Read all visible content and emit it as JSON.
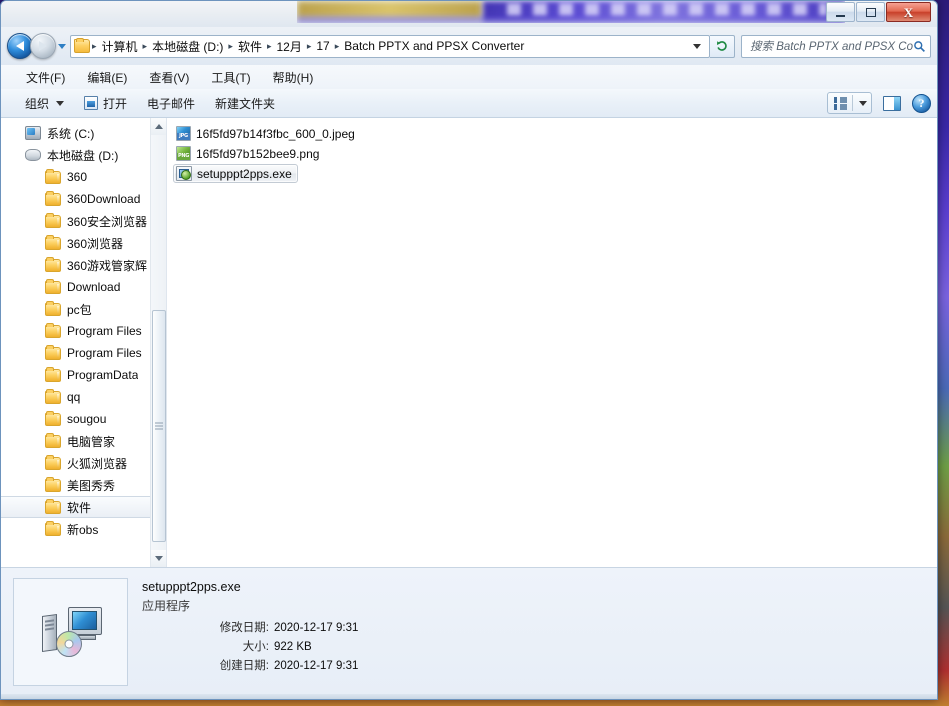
{
  "window": {
    "title_obscured": true,
    "controls": {
      "minimize": "minimize",
      "maximize": "maximize",
      "close": "close"
    }
  },
  "address_bar": {
    "back_tooltip": "后退",
    "forward_tooltip": "前进",
    "folder_icon": "folder-icon",
    "breadcrumbs": [
      "计算机",
      "本地磁盘 (D:)",
      "软件",
      "12月",
      "17",
      "Batch PPTX and PPSX Converter"
    ],
    "separator": "▸",
    "refresh_icon": "refresh-icon",
    "search": {
      "placeholder": "搜索 Batch PPTX and PPSX Conver...",
      "value": "",
      "icon": "search-icon"
    }
  },
  "menubar": [
    {
      "label": "文件(F)",
      "key": "F"
    },
    {
      "label": "编辑(E)",
      "key": "E"
    },
    {
      "label": "查看(V)",
      "key": "V"
    },
    {
      "label": "工具(T)",
      "key": "T"
    },
    {
      "label": "帮助(H)",
      "key": "H"
    }
  ],
  "toolbar": {
    "organize": "组织",
    "open": "打开",
    "email": "电子邮件",
    "new_folder": "新建文件夹",
    "view_icon": "view-options-icon",
    "preview_pane_icon": "preview-pane-icon",
    "help_icon": "help-icon"
  },
  "nav_pane": {
    "items": [
      {
        "label": "系统 (C:)",
        "icon": "drive-c-icon",
        "level": 1,
        "selected": false
      },
      {
        "label": "本地磁盘 (D:)",
        "icon": "drive-d-icon",
        "level": 1,
        "selected": false
      },
      {
        "label": "360",
        "icon": "folder-icon",
        "level": 2,
        "selected": false
      },
      {
        "label": "360Download",
        "icon": "folder-icon",
        "level": 2,
        "selected": false
      },
      {
        "label": "360安全浏览器",
        "icon": "folder-icon",
        "level": 2,
        "selected": false
      },
      {
        "label": "360浏览器",
        "icon": "folder-icon",
        "level": 2,
        "selected": false
      },
      {
        "label": "360游戏管家辉",
        "icon": "folder-icon",
        "level": 2,
        "selected": false
      },
      {
        "label": "Download",
        "icon": "folder-icon",
        "level": 2,
        "selected": false
      },
      {
        "label": "pc包",
        "icon": "folder-icon",
        "level": 2,
        "selected": false
      },
      {
        "label": "Program Files",
        "icon": "folder-icon",
        "level": 2,
        "selected": false
      },
      {
        "label": "Program Files",
        "icon": "folder-icon",
        "level": 2,
        "selected": false
      },
      {
        "label": "ProgramData",
        "icon": "folder-icon",
        "level": 2,
        "selected": false
      },
      {
        "label": "qq",
        "icon": "folder-icon",
        "level": 2,
        "selected": false
      },
      {
        "label": "sougou",
        "icon": "folder-icon",
        "level": 2,
        "selected": false
      },
      {
        "label": "电脑管家",
        "icon": "folder-icon",
        "level": 2,
        "selected": false
      },
      {
        "label": "火狐浏览器",
        "icon": "folder-icon",
        "level": 2,
        "selected": false
      },
      {
        "label": "美图秀秀",
        "icon": "folder-icon",
        "level": 2,
        "selected": false
      },
      {
        "label": "软件",
        "icon": "folder-icon",
        "level": 2,
        "selected": true
      },
      {
        "label": "新obs",
        "icon": "folder-icon",
        "level": 2,
        "selected": false
      }
    ]
  },
  "file_list": {
    "files": [
      {
        "name": "16f5fd97b14f3fbc_600_0.jpeg",
        "icon": "jpeg-file-icon",
        "badge": "JPG",
        "selected": false
      },
      {
        "name": "16f5fd97b152bee9.png",
        "icon": "png-file-icon",
        "badge": "PNG",
        "selected": false
      },
      {
        "name": "setupppt2pps.exe",
        "icon": "exe-file-icon",
        "badge": "",
        "selected": true
      }
    ]
  },
  "details_pane": {
    "thumbnail_icon": "setup-program-icon",
    "file_name": "setupppt2pps.exe",
    "file_type": "应用程序",
    "rows": [
      {
        "label": "修改日期:",
        "value": "2020-12-17 9:31"
      },
      {
        "label": "大小:",
        "value": "922 KB"
      },
      {
        "label": "创建日期:",
        "value": "2020-12-17 9:31"
      }
    ]
  },
  "colors": {
    "accent_blue": "#2f8ddc",
    "close_red": "#c8402a",
    "folder_yellow": "#fdd468",
    "details_bg": "#eef3fa",
    "selection_border": "#c3cbd4"
  }
}
